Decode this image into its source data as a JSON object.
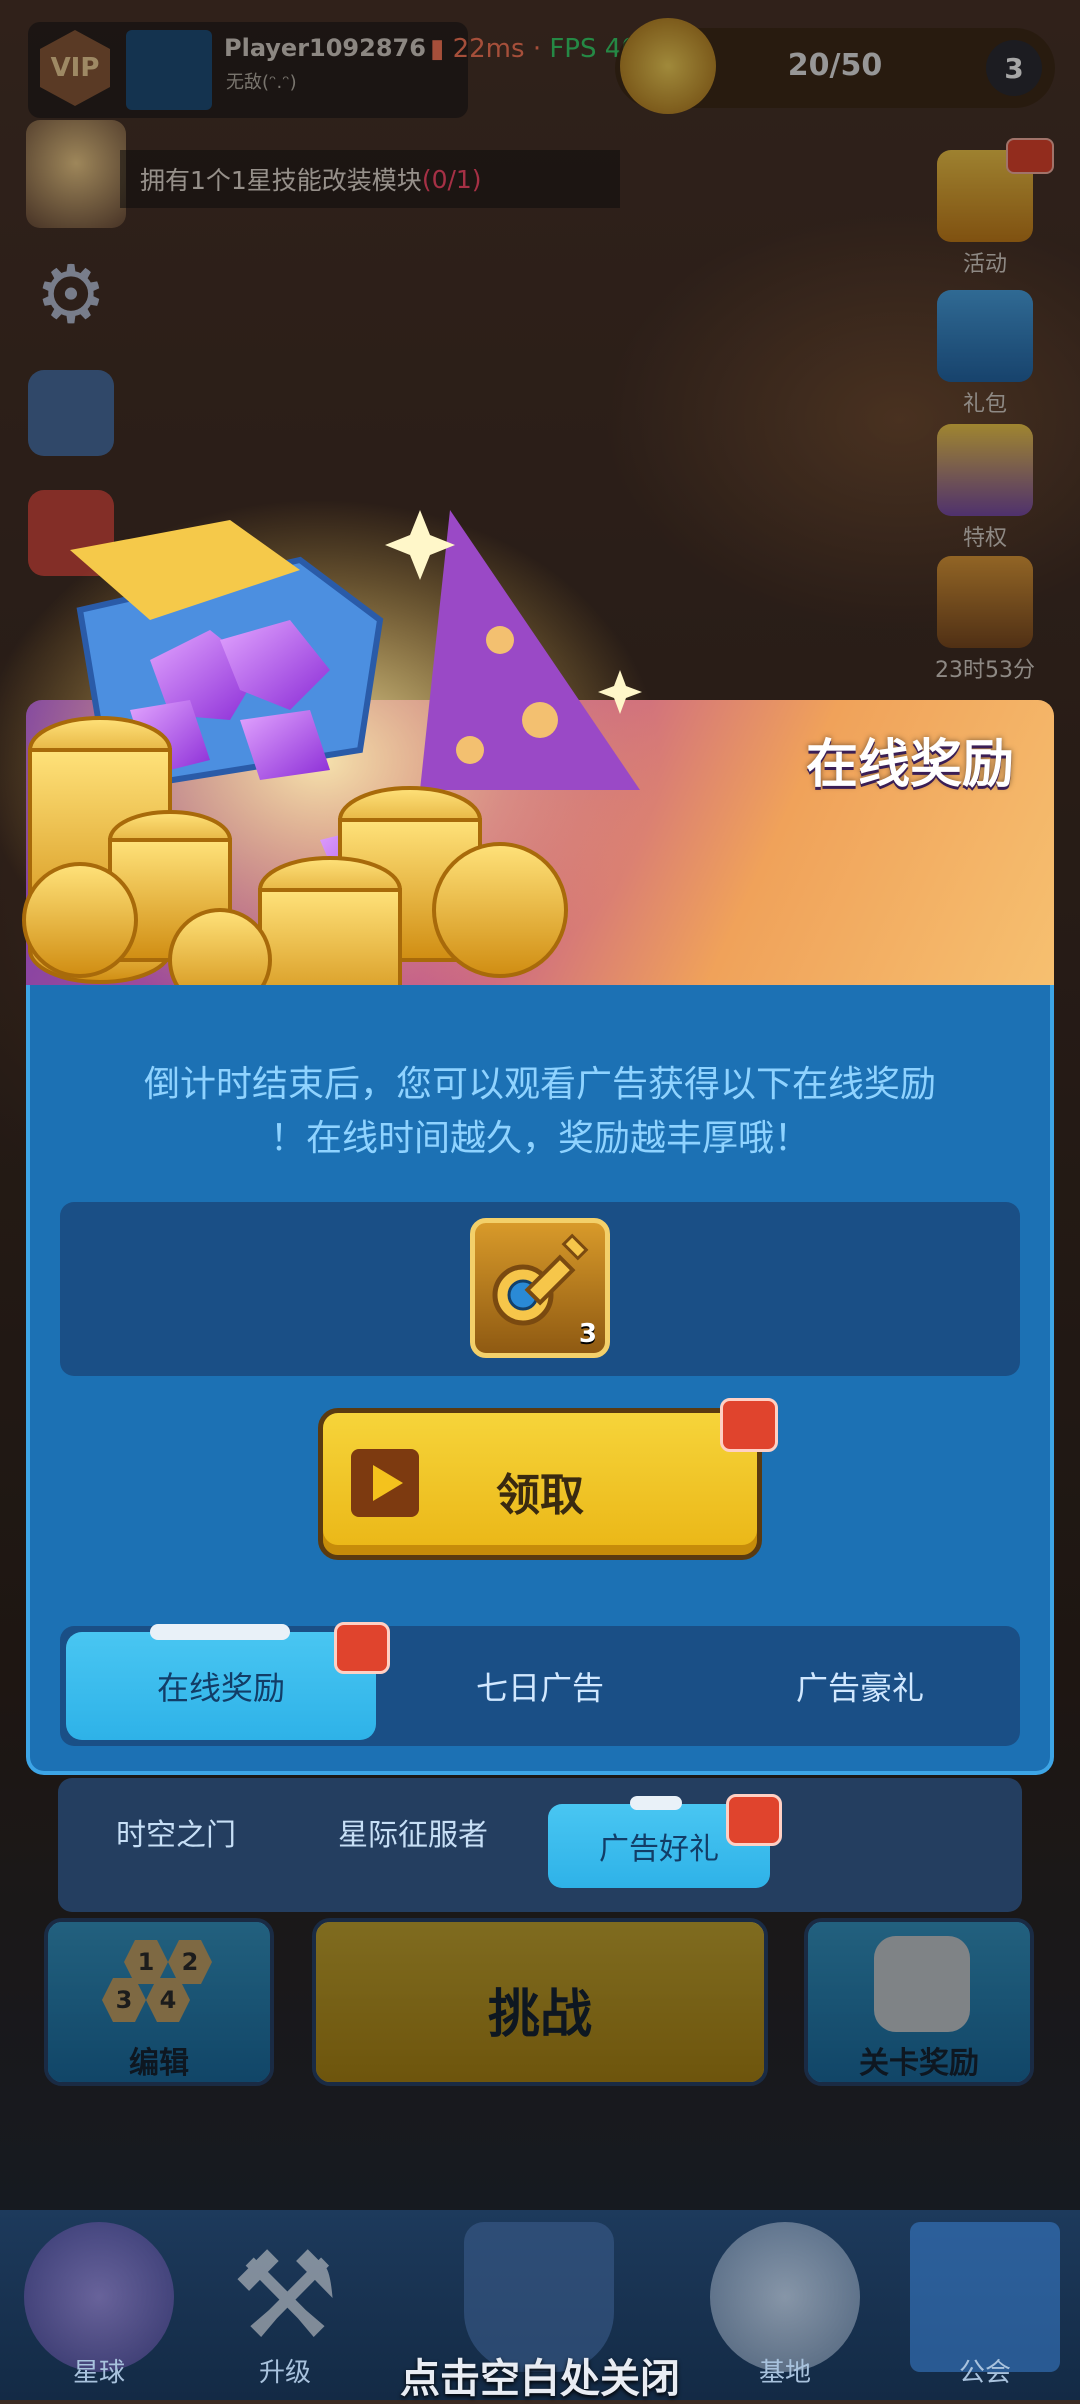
{
  "status_overlay": {
    "ping": "22ms",
    "separator": "·",
    "fps": "FPS 40"
  },
  "player": {
    "vip_label": "VIP",
    "name": "Player1092876",
    "subtitle": "无敌(ᵔ.ᵔ)"
  },
  "level": {
    "progress_text": "20/50",
    "progress_value": 0.4,
    "rank": "3"
  },
  "quest": {
    "text": "拥有1个1星技能改装模块",
    "progress": "(0/1)"
  },
  "side_buttons": [
    {
      "label": "活动"
    },
    {
      "label": "礼包"
    },
    {
      "label": "特权"
    },
    {
      "label": "23时53分"
    }
  ],
  "popup": {
    "title": "在线奖励",
    "description_line1": "倒计时结束后，您可以观看广告获得以下在线奖励",
    "description_line2": "！在线时间越久，奖励越丰厚哦！",
    "reward_count": "3",
    "claim_label": "领取",
    "tabs": [
      {
        "label": "在线奖励",
        "active": true
      },
      {
        "label": "七日广告",
        "active": false
      },
      {
        "label": "广告豪礼",
        "active": false
      }
    ]
  },
  "game_modes": [
    {
      "label": "时空之门"
    },
    {
      "label": "星际征服者"
    },
    {
      "label": "广告好礼",
      "active": true
    }
  ],
  "game_buttons": {
    "edit_label": "编辑",
    "fight_label": "挑战",
    "reward_label": "关卡奖励",
    "hex_numbers": [
      "1",
      "2",
      "3",
      "4"
    ]
  },
  "bottom_nav": [
    {
      "label": "星球",
      "icon": "planet-icon"
    },
    {
      "label": "升级",
      "icon": "tools-icon"
    },
    {
      "label": "",
      "icon": "shield-icon"
    },
    {
      "label": "基地",
      "icon": "station-icon"
    },
    {
      "label": "公会",
      "icon": "banner-icon"
    }
  ],
  "close_hint": "点击空白处关闭"
}
